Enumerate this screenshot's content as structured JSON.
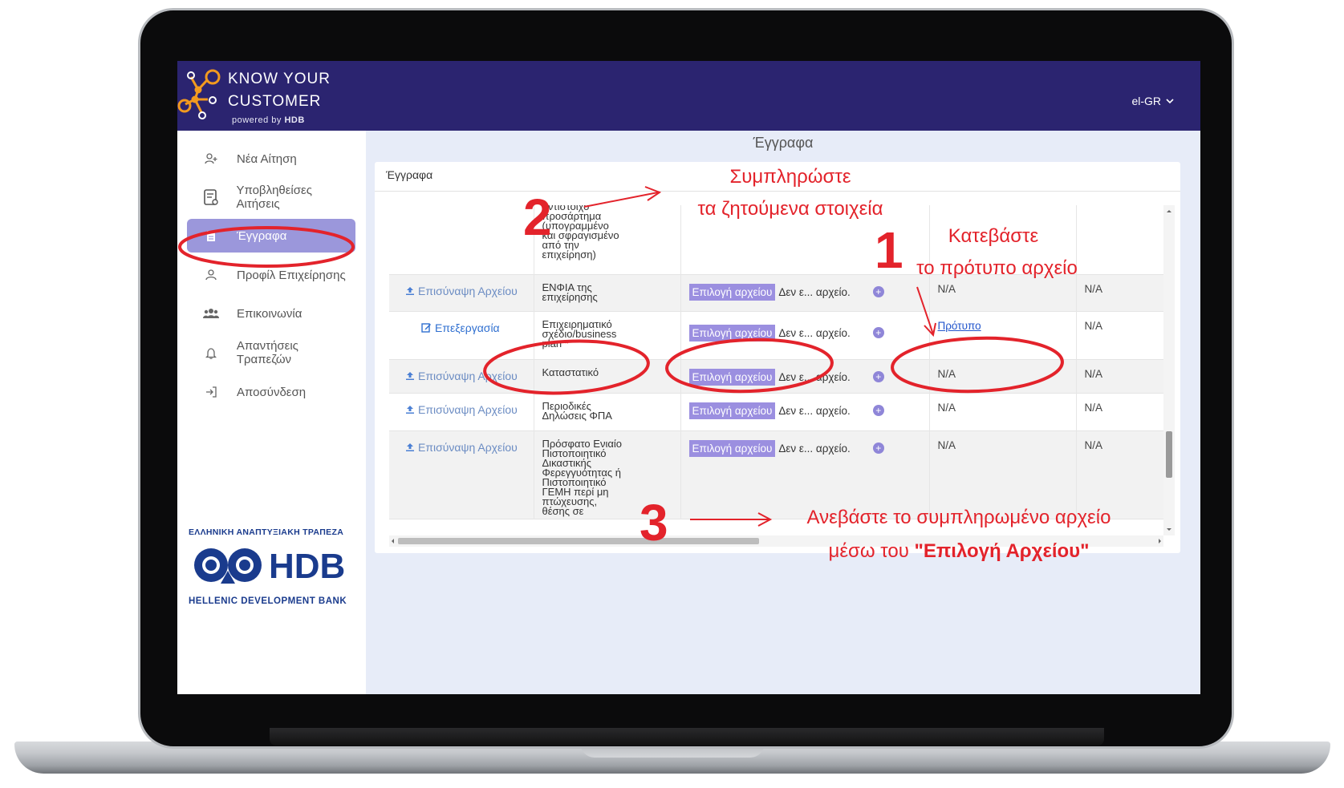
{
  "app": {
    "logo_line1": "KNOW YOUR",
    "logo_line2": "CUSTOMER",
    "logo_powered": "powered by",
    "logo_brand": "HDB",
    "language": "el-GR",
    "brand_color": "#2b2470",
    "accent_color": "#9b97db"
  },
  "sidebar": {
    "items": [
      {
        "label": "Νέα Αίτηση",
        "icon": "add-user-icon"
      },
      {
        "label": "Υποβληθείσες Αιτήσεις",
        "icon": "submitted-form-icon"
      },
      {
        "label": "Έγγραφα",
        "icon": "document-icon",
        "active": true
      },
      {
        "label": "Προφίλ Επιχείρησης",
        "icon": "user-icon"
      },
      {
        "label": "Επικοινωνία",
        "icon": "users-icon"
      },
      {
        "label": "Απαντήσεις Τραπεζών",
        "icon": "bell-icon"
      },
      {
        "label": "Αποσύνδεση",
        "icon": "logout-icon"
      }
    ],
    "bank_greek": "ΕΛΛΗΝΙΚΗ ΑΝΑΠΤΥΞΙΑΚΗ ΤΡΑΠΕΖΑ",
    "bank_logo_text": "HDB",
    "bank_english": "HELLENIC DEVELOPMENT BANK"
  },
  "main": {
    "page_title": "Έγγραφα",
    "card_title": "Έγγραφα",
    "rows": [
      {
        "action": "",
        "doc": [
          "αντίστοιχο",
          "προσάρτημα",
          "(υπογραμμένο",
          "και σφραγισμένο",
          "από την",
          "επιχείρηση)"
        ],
        "required": false,
        "choose": "",
        "nofile": "",
        "template": "",
        "col5": ""
      },
      {
        "action": "Επισύναψη Αρχείου",
        "doc": [
          "ΕΝΦΙΑ της",
          "επιχείρησης"
        ],
        "required": false,
        "choose": "Επιλογή αρχείου",
        "nofile": "Δεν ε... αρχείο.",
        "template": "N/A",
        "col5": "N/A"
      },
      {
        "action": "Επεξεργασία",
        "doc": [
          "Επιχειρηματικό",
          "σχέδιο/business",
          "plan"
        ],
        "required": true,
        "choose": "Επιλογή αρχείου",
        "nofile": "Δεν ε... αρχείο.",
        "template": "Πρότυπο",
        "col5": "N/A"
      },
      {
        "action": "Επισύναψη Αρχείου",
        "doc": [
          "Καταστατικό"
        ],
        "required": false,
        "choose": "Επιλογή αρχείου",
        "nofile": "Δεν ε... αρχείο.",
        "template": "N/A",
        "col5": "N/A"
      },
      {
        "action": "Επισύναψη Αρχείου",
        "doc": [
          "Περιοδικές",
          "Δηλώσεις ΦΠΑ"
        ],
        "required": false,
        "choose": "Επιλογή αρχείου",
        "nofile": "Δεν ε... αρχείο.",
        "template": "N/A",
        "col5": "N/A"
      },
      {
        "action": "Επισύναψη Αρχείου",
        "doc": [
          "Πρόσφατο Ενιαίο",
          "Πιστοποιητικό",
          "Δικαστικής",
          "Φερεγγυότητας ή",
          "Πιστοποιητικό",
          "ΓΕΜΗ περί μη",
          "πτώχευσης,",
          "θέσης σε"
        ],
        "required": false,
        "choose": "Επιλογή αρχείου",
        "nofile": "Δεν ε... αρχείο.",
        "template": "N/A",
        "col5": "N/A"
      }
    ]
  },
  "annotations": {
    "color": "#e3232b",
    "step1_number": "1",
    "step1_line1": "Κατεβάστε",
    "step1_line2": "το πρότυπο αρχείο",
    "step2_number": "2",
    "step2_line1": "Συμπληρώστε",
    "step2_line2": "τα ζητούμενα στοιχεία",
    "step3_number": "3",
    "step3_line1": "Ανεβάστε το συμπληρωμένο αρχείο",
    "step3_line2_prefix": "μέσω του ",
    "step3_line2_bold": "\"Επιλογή Αρχείου\""
  }
}
